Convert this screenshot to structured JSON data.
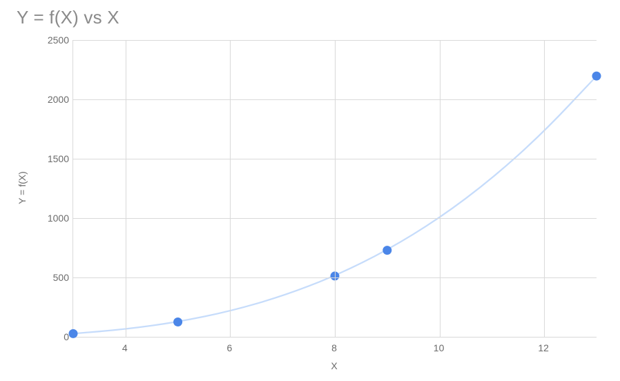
{
  "title": "Y = f(X) vs X",
  "xlabel": "X",
  "ylabel": "Y = f(X)",
  "y_ticks": [
    "0",
    "500",
    "1000",
    "1500",
    "2000",
    "2500"
  ],
  "x_ticks": [
    "4",
    "6",
    "8",
    "10",
    "12"
  ],
  "chart_data": {
    "type": "scatter",
    "title": "Y = f(X) vs X",
    "xlabel": "X",
    "ylabel": "Y = f(X)",
    "xlim": [
      3,
      13
    ],
    "ylim": [
      0,
      2500
    ],
    "series": [
      {
        "name": "points",
        "kind": "markers",
        "x": [
          3,
          5,
          8,
          9,
          13
        ],
        "y": [
          27,
          125,
          512,
          729,
          2197
        ]
      },
      {
        "name": "trend",
        "kind": "line",
        "x": [
          3,
          4,
          5,
          6,
          7,
          8,
          9,
          10,
          11,
          12,
          13
        ],
        "y": [
          27,
          64,
          125,
          216,
          343,
          512,
          729,
          1000,
          1331,
          1728,
          2197
        ]
      }
    ],
    "grid": true,
    "legend": false
  }
}
